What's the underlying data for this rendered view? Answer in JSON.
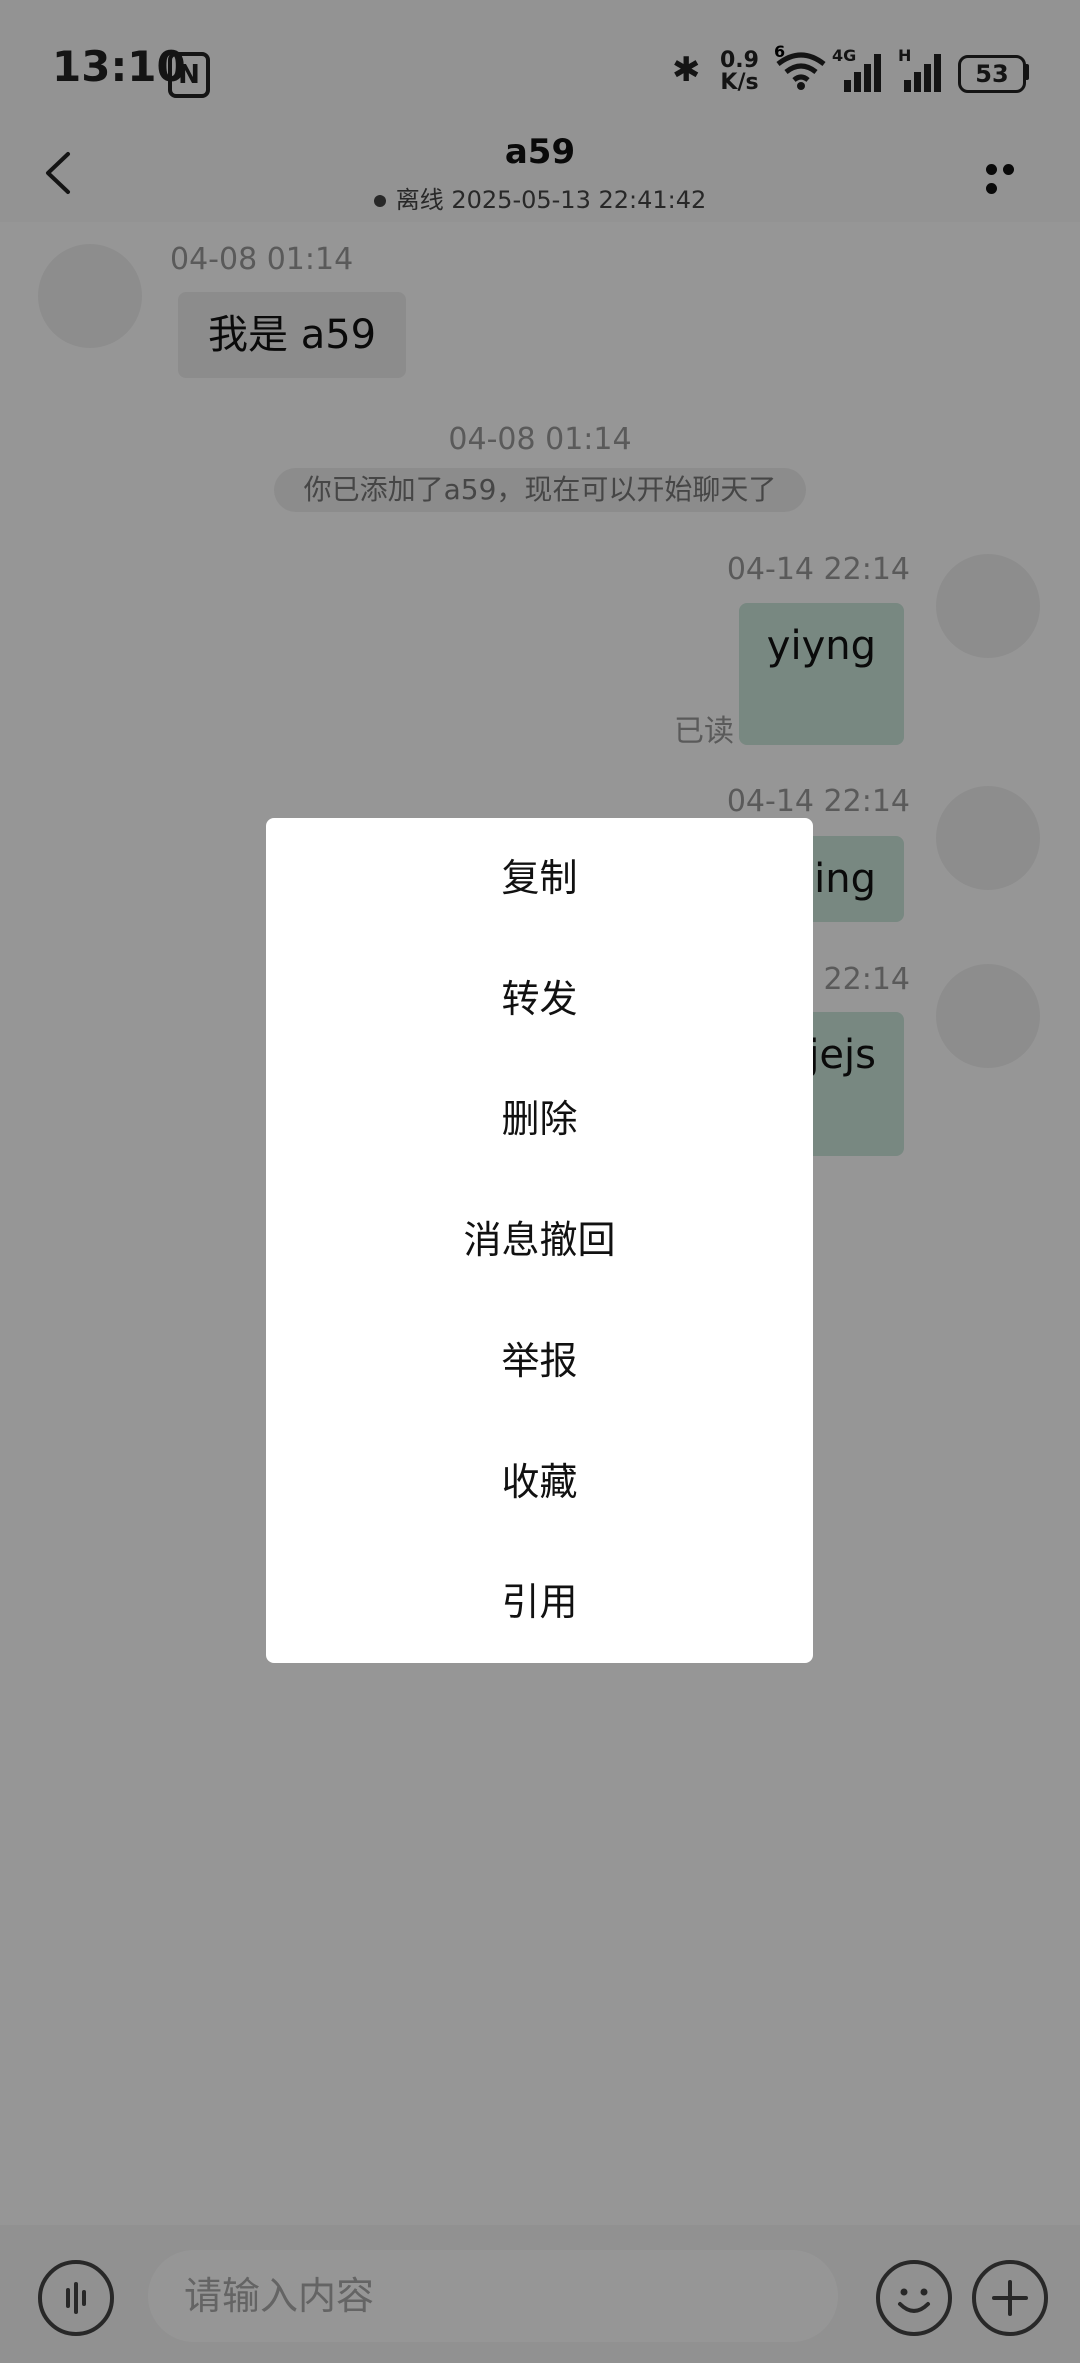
{
  "status_bar": {
    "time": "13:10",
    "nfc": "N",
    "net_speed_value": "0.9",
    "net_speed_unit": "K/s",
    "wifi_badge": "6",
    "sim1_badge": "4G",
    "sim2_badge": "H",
    "battery": "53"
  },
  "header": {
    "title": "a59",
    "status_text": "离线 2025-05-13 22:41:42"
  },
  "messages": [
    {
      "time": "04-08 01:14",
      "text": "我是 a59",
      "direction": "in"
    },
    {
      "time": "04-08 01:14",
      "system_text": "你已添加了a59，现在可以开始聊天了"
    },
    {
      "time": "04-14 22:14",
      "text": "yiyng",
      "direction": "out",
      "read_label": "已读"
    },
    {
      "time": "04-14 22:14",
      "text": "ing",
      "direction": "out"
    },
    {
      "time": "4 22:14",
      "text": "jejs",
      "direction": "out"
    }
  ],
  "input": {
    "placeholder": "请输入内容"
  },
  "context_menu": {
    "items": [
      "复制",
      "转发",
      "删除",
      "消息撤回",
      "举报",
      "收藏",
      "引用"
    ]
  },
  "colors": {
    "outgoing_bubble": "#cde8dc",
    "overlay": "rgba(0,0,0,0.41)"
  }
}
